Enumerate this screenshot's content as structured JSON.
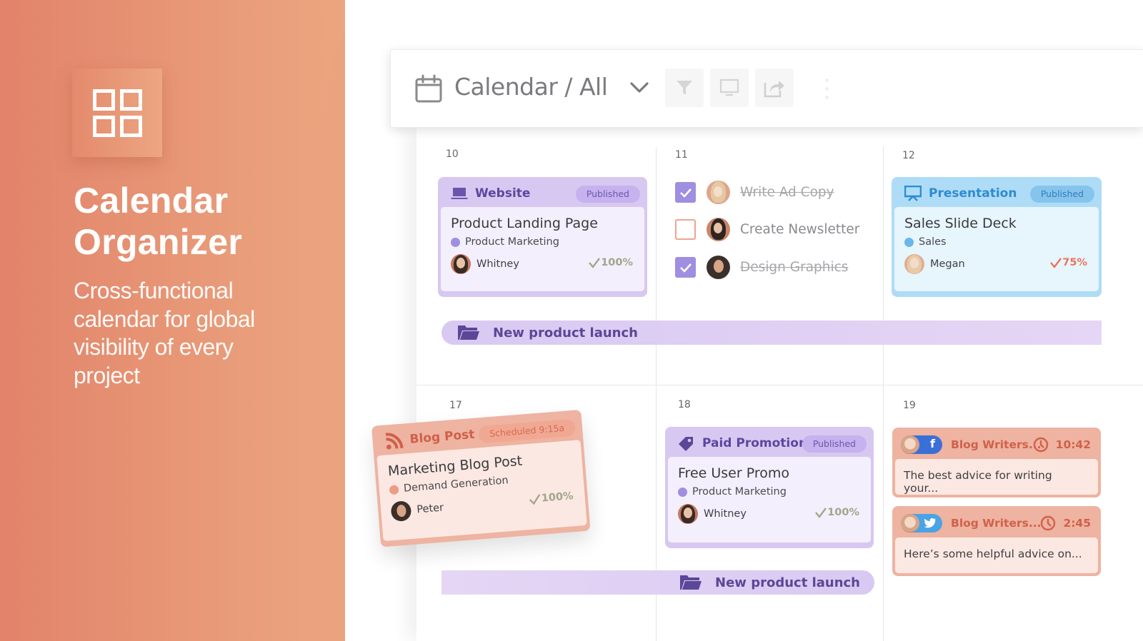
{
  "hero": {
    "title_line1": "Calendar",
    "title_line2": "Organizer",
    "subtitle": "Cross-functional calendar for global visibility of every project",
    "icon": "grid-icon",
    "bg_color_start": "#e2836a",
    "bg_color_end": "#eca580"
  },
  "toolbar": {
    "icon": "calendar-icon",
    "title": "Calendar / All",
    "dropdown_icon": "chevron-down-icon",
    "buttons": [
      {
        "name": "filter",
        "icon": "filter-icon"
      },
      {
        "name": "present",
        "icon": "monitor-icon"
      },
      {
        "name": "share",
        "icon": "share-icon"
      }
    ],
    "more_icon": "more-vertical-icon"
  },
  "weeks": [
    {
      "days": [
        {
          "num": "10"
        },
        {
          "num": "11"
        },
        {
          "num": "12"
        }
      ]
    },
    {
      "days": [
        {
          "num": "17"
        },
        {
          "num": "18"
        },
        {
          "num": "19"
        }
      ]
    }
  ],
  "cards": {
    "website": {
      "type": "Website",
      "icon": "laptop-icon",
      "status": "Published",
      "title": "Product Landing Page",
      "category": "Product Marketing",
      "category_color": "#a08ee1",
      "assignee": "Whitney",
      "progress": "100%",
      "progress_color": "#a3a58c"
    },
    "presentation": {
      "type": "Presentation",
      "icon": "presentation-icon",
      "status": "Published",
      "title": "Sales Slide Deck",
      "category": "Sales",
      "category_color": "#6ab8ea",
      "assignee": "Megan",
      "progress": "75%",
      "progress_color": "#e7765a"
    },
    "blog": {
      "type": "Blog Post",
      "icon": "rss-icon",
      "status": "Scheduled 9:15a",
      "title": "Marketing Blog Post",
      "category": "Demand Generation",
      "category_color": "#ec9c84",
      "assignee": "Peter",
      "progress": "100%",
      "progress_color": "#a3a58c"
    },
    "promo": {
      "type": "Paid Promotion",
      "icon": "tag-icon",
      "status": "Published",
      "title": "Free User Promo",
      "category": "Product Marketing",
      "category_color": "#a08ee1",
      "assignee": "Whitney",
      "progress": "100%",
      "progress_color": "#a3a58c"
    }
  },
  "tasks": [
    {
      "label": "Write Ad Copy",
      "done": true
    },
    {
      "label": "Create Newsletter",
      "done": false
    },
    {
      "label": "Design Graphics",
      "done": true
    }
  ],
  "projects": [
    {
      "label": "New product launch",
      "icon": "folder-icon"
    },
    {
      "label": "New product launch",
      "icon": "folder-icon"
    }
  ],
  "social_posts": [
    {
      "network": "facebook",
      "glyph": "f",
      "network_color": "#3b6fd8",
      "name": "Blog Writers...",
      "time": "10:42",
      "text": "The best advice for writing your..."
    },
    {
      "network": "twitter",
      "glyph": "🐦",
      "network_color": "#4aa3e6",
      "name": "Blog Writers...",
      "time": "2:45",
      "text": "Here’s some helpful advice on..."
    }
  ]
}
